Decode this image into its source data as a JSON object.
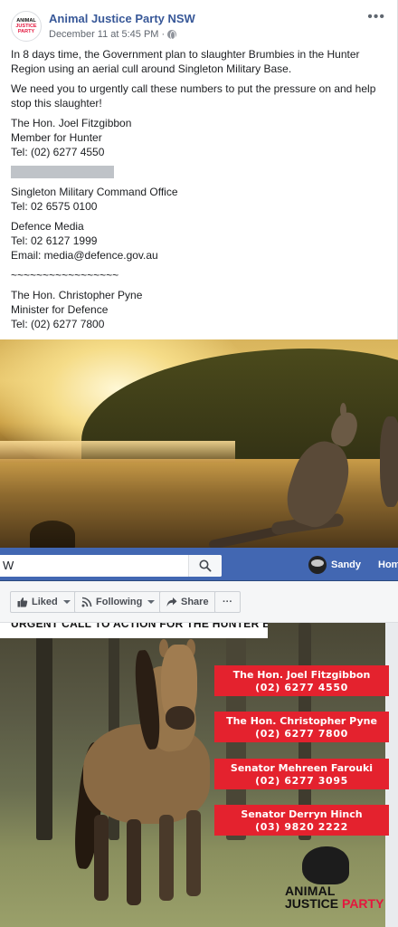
{
  "post": {
    "page_name": "Animal Justice Party NSW",
    "timestamp": "December 11 at 5:45 PM",
    "separator": "·",
    "avatar_text_a": "ANIMAL",
    "avatar_text_b": "JUSTICE PARTY",
    "paragraphs": [
      "In 8 days time, the Government plan to slaughter Brumbies in the Hunter Region using an aerial cull around Singleton Military Base.",
      "We need you to urgently call these numbers to put the pressure on and help stop this slaughter!"
    ],
    "contacts": [
      {
        "line1": "The Hon. Joel Fitzgibbon",
        "line2": "Member for Hunter",
        "line3": "Tel: (02) 6277 4550"
      },
      {
        "line1": "Singleton Military Command Office",
        "line2": "Tel: 02 6575 0100"
      },
      {
        "line1": "Defence Media",
        "line2": "Tel: 02 6127 1999",
        "line3": "Email: media@defence.gov.au"
      },
      {
        "line1": "The Hon. Christopher Pyne",
        "line2": "Minister for Defence",
        "line3": "Tel: (02) 6277 7800"
      }
    ],
    "divider_1": "~~~~~~~~~~~~~~~~",
    "divider_2": "~~~~~~~~~~~~~~~~~"
  },
  "fb_bar": {
    "search_value": "W",
    "user_name": "Sandy",
    "home_label": "Home"
  },
  "actions": {
    "liked_label": "Liked",
    "following_label": "Following",
    "share_label": "Share",
    "more_label": "···"
  },
  "poster": {
    "banner": "URGENT CALL TO ACTION FOR THE HUNTER BRUMBIES",
    "boxes": [
      {
        "name": "The Hon. Joel Fitzgibbon",
        "phone": "(02) 6277 4550"
      },
      {
        "name": "The Hon. Christopher Pyne",
        "phone": "(02) 6277 7800"
      },
      {
        "name": "Senator Mehreen Farouki",
        "phone": "(02) 6277 3095"
      },
      {
        "name": "Senator Derryn Hinch",
        "phone": "(03) 9820 2222"
      }
    ],
    "logo_line1": "ANIMAL",
    "logo_line2a": "JUSTICE",
    "logo_line2b": "PARTY"
  },
  "colors": {
    "facebook_blue": "#4267b2",
    "link_blue": "#385898",
    "poster_red": "#e4222e",
    "party_red": "#e4173e"
  },
  "icons": [
    "more-icon",
    "globe-icon",
    "search-icon",
    "thumbs-up-icon",
    "rss-icon",
    "share-arrow-icon",
    "caret-down-icon"
  ]
}
